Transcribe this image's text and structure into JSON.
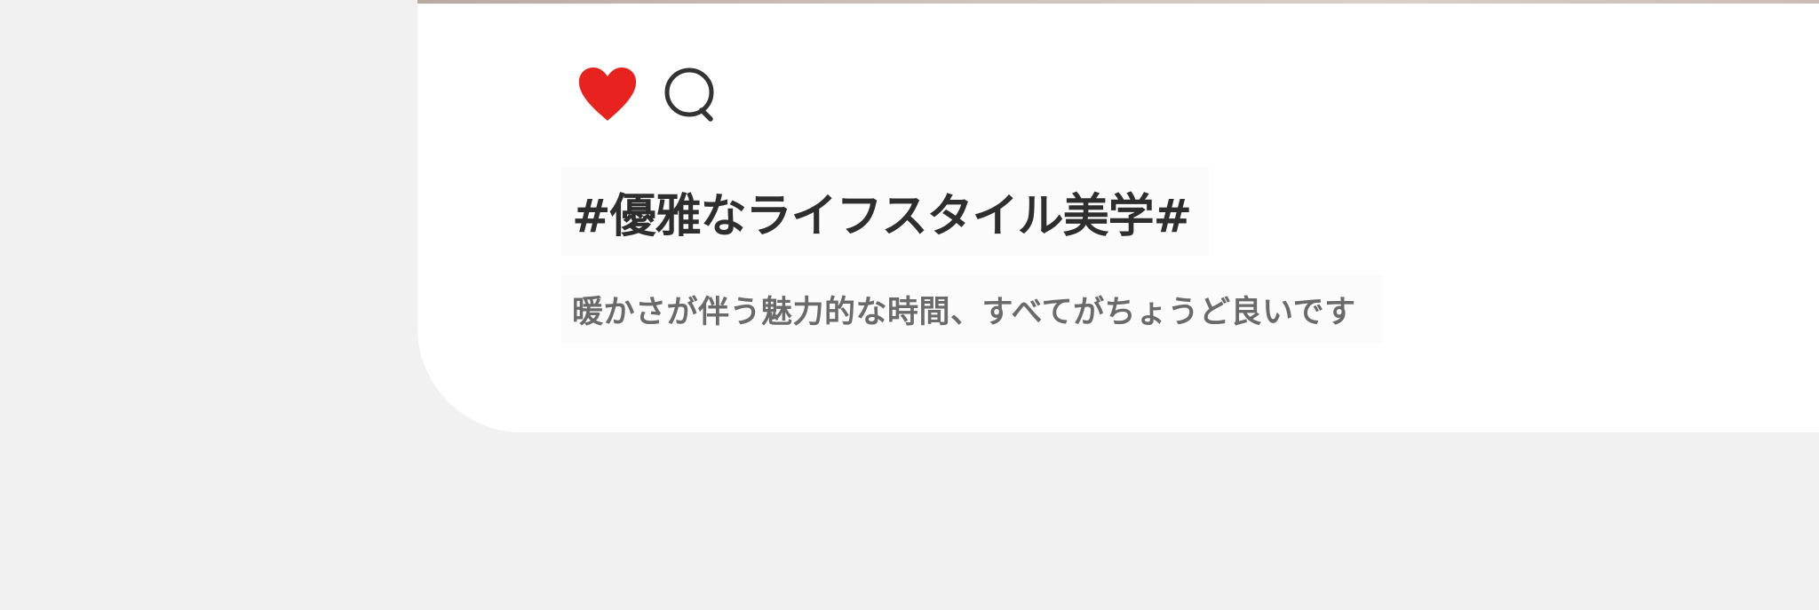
{
  "post": {
    "title": "#優雅なライフスタイル美学#",
    "subtitle": "暖かさが伴う魅力的な時間、すべてがちょうど良いです"
  },
  "actions": {
    "like_icon": "heart-icon",
    "comment_icon": "comment-bubble-icon",
    "like_color": "#e8221f",
    "icon_stroke_color": "#333333"
  },
  "colors": {
    "background": "#f1f1f1",
    "card": "#ffffff",
    "title_text": "#2e2e2e",
    "subtitle_text": "#6a6a6a"
  }
}
